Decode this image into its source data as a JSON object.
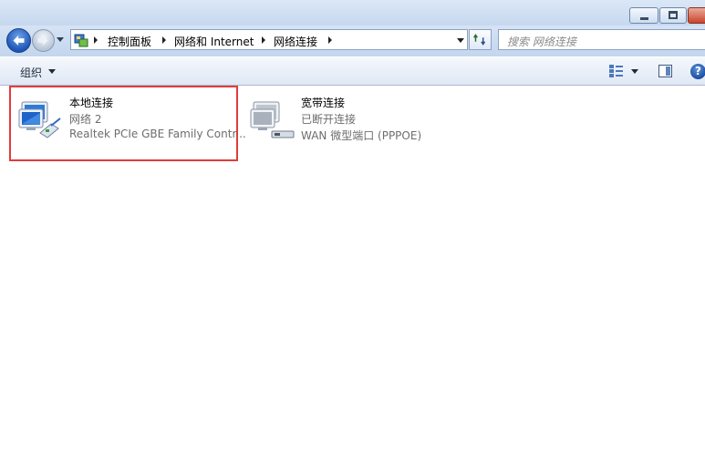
{
  "breadcrumbs": [
    "控制面板",
    "网络和 Internet",
    "网络连接"
  ],
  "search": {
    "placeholder": "搜索 网络连接"
  },
  "toolbar": {
    "organize_label": "组织"
  },
  "help_glyph": "?",
  "connections": [
    {
      "name": "本地连接",
      "status": "网络  2",
      "device": "Realtek PCIe GBE Family Contr...",
      "icon": "lan-connection-icon"
    },
    {
      "name": "宽带连接",
      "status": "已断开连接",
      "device": "WAN 微型端口 (PPPOE)",
      "icon": "broadband-connection-icon"
    }
  ],
  "colors": {
    "highlight_border": "#e23b3b",
    "toolbar_bg": "#dfe8f5"
  }
}
